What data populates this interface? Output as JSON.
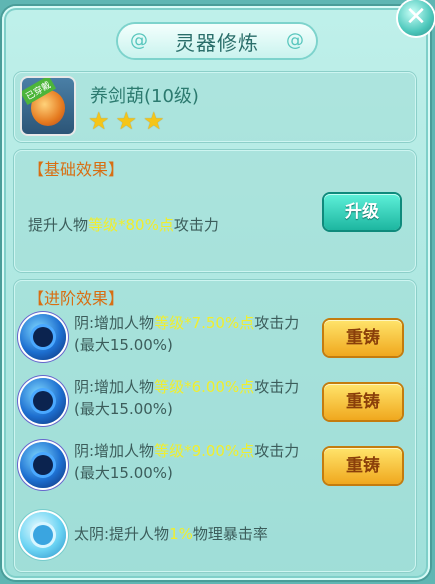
{
  "window": {
    "title": "灵器修炼",
    "close_icon": "close-icon"
  },
  "item": {
    "name": "养剑葫(10级)",
    "badge": "已穿戴",
    "stars": 3,
    "star_glyph": "★"
  },
  "basic": {
    "title": "【基础效果】",
    "desc_prefix": "提升人物",
    "desc_highlight": "等级*80%点",
    "desc_suffix": "攻击力",
    "upgrade_label": "升级"
  },
  "advanced": {
    "title": "【进阶效果】",
    "rows": [
      {
        "prefix": "阴:增加人物",
        "highlight": "等级*7.50%点",
        "suffix": "攻击力(最大15.00%)",
        "button": "重铸"
      },
      {
        "prefix": "阴:增加人物",
        "highlight": "等级*6.00%点",
        "suffix": "攻击力(最大15.00%)",
        "button": "重铸"
      },
      {
        "prefix": "阴:增加人物",
        "highlight": "等级*9.00%点",
        "suffix": "攻击力(最大15.00%)",
        "button": "重铸"
      },
      {
        "prefix": "太阴:提升人物",
        "highlight": "1%",
        "suffix": "物理暴击率",
        "button": ""
      }
    ]
  },
  "colors": {
    "highlight": "#f0ee2e",
    "section_title": "#d86e12",
    "accent": "#1db6a0"
  }
}
